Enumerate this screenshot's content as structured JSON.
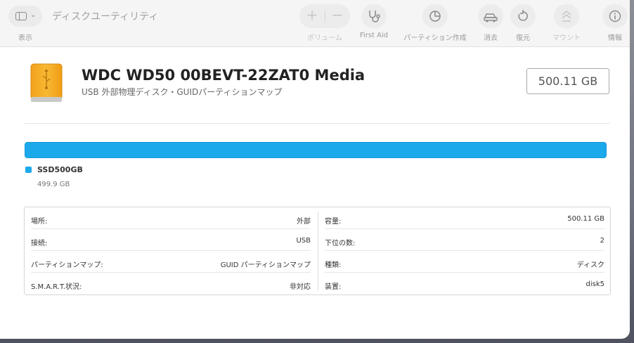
{
  "toolbar": {
    "view_label": "表示",
    "app_title": "ディスクユーティリティ",
    "volume_label": "ボリューム",
    "first_aid_label": "First Aid",
    "partition_label": "パーティション作成",
    "erase_label": "消去",
    "restore_label": "復元",
    "mount_label": "マウント",
    "info_label": "情報",
    "icons": [
      "sidebar-icon",
      "plus-icon",
      "minus-icon",
      "stethoscope-icon",
      "pie-chart-icon",
      "car-erase-icon",
      "restore-icon",
      "mount-icon",
      "info-icon"
    ]
  },
  "disk": {
    "name": "WDC WD50 00BEVT-22ZAT0 Media",
    "subtitle": "USB 外部物理ディスク・GUIDパーティションマップ",
    "size": "500.11 GB",
    "icon": "external-drive-icon",
    "icon_color": "#f5a623"
  },
  "usage": {
    "color": "#1ca9ec",
    "used_fraction": 1.0,
    "partition_name": "SSD500GB",
    "partition_size": "499.9 GB"
  },
  "info": {
    "left": [
      {
        "key": "場所:",
        "value": "外部"
      },
      {
        "key": "接続:",
        "value": "USB"
      },
      {
        "key": "パーティションマップ:",
        "value": "GUID パーティションマップ"
      },
      {
        "key": "S.M.A.R.T.状況:",
        "value": "非対応"
      }
    ],
    "right": [
      {
        "key": "容量:",
        "value": "500.11 GB"
      },
      {
        "key": "下位の数:",
        "value": "2"
      },
      {
        "key": "種類:",
        "value": "ディスク"
      },
      {
        "key": "装置:",
        "value": "disk5"
      }
    ]
  }
}
